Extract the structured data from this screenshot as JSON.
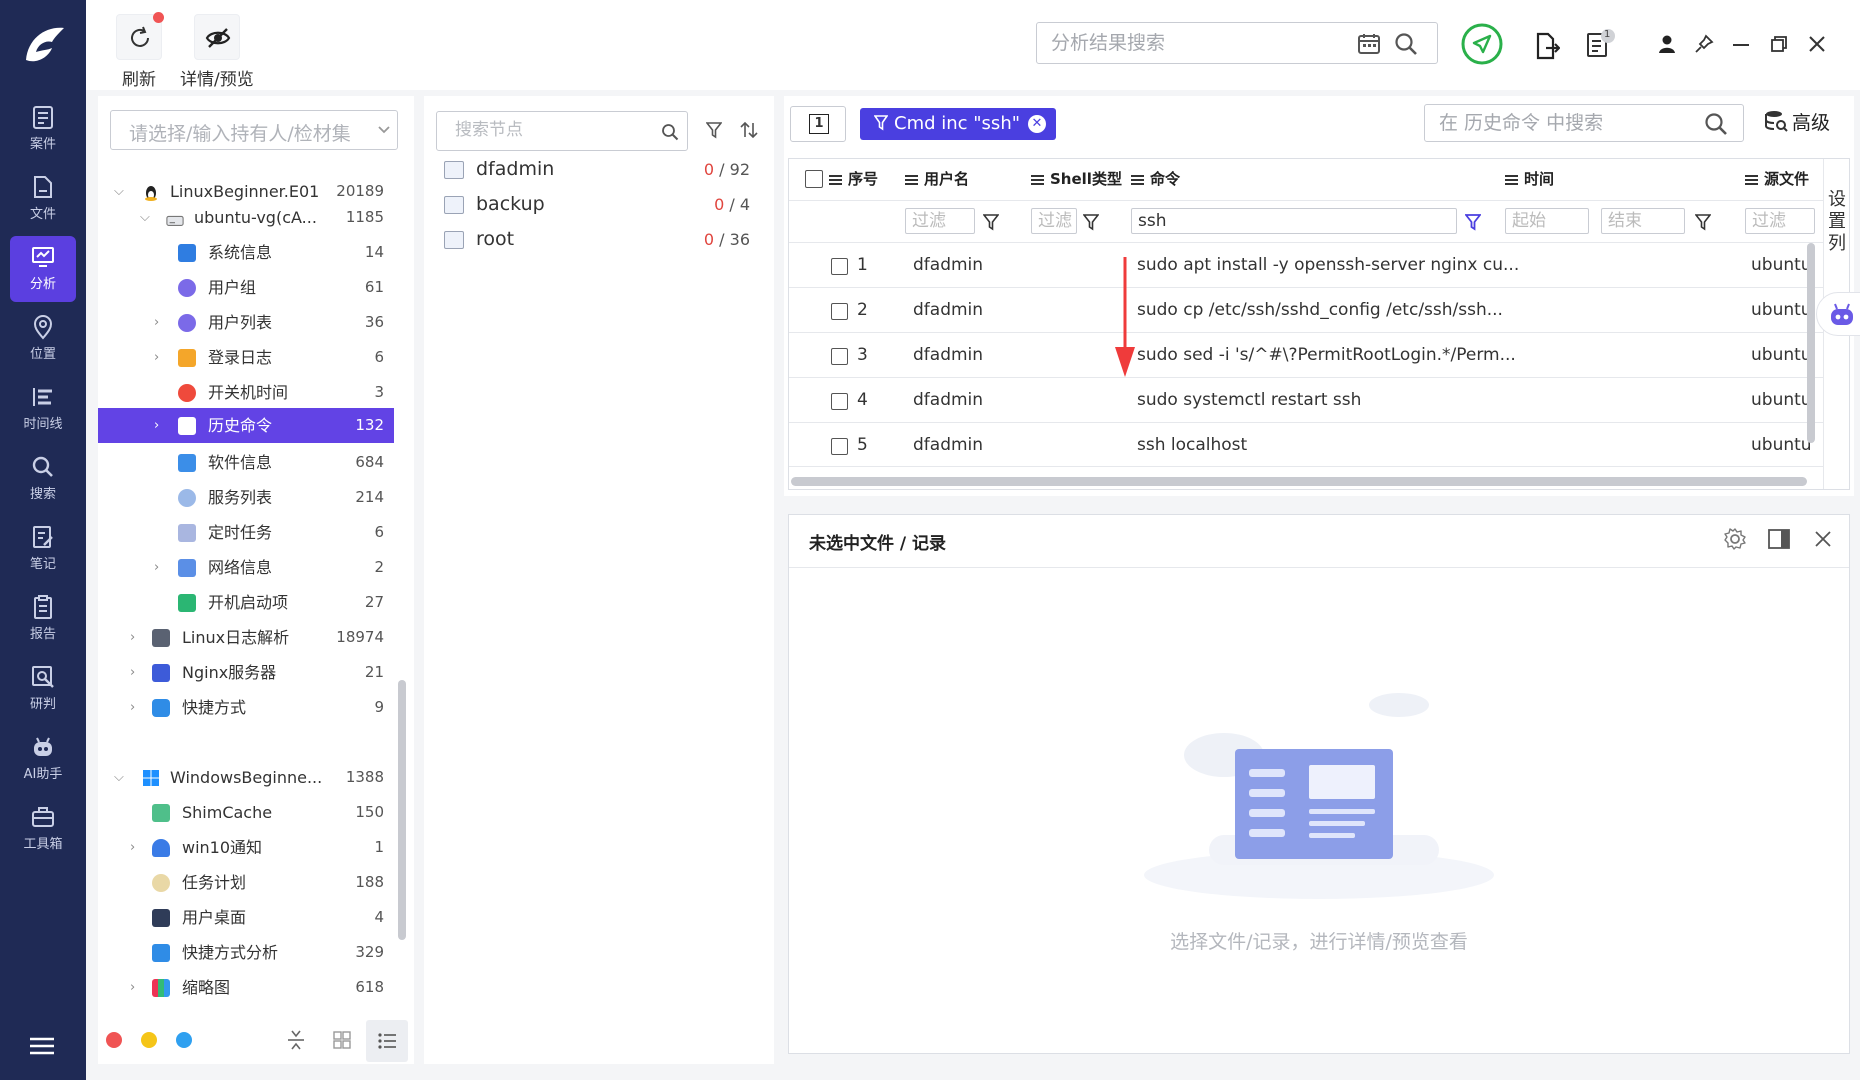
{
  "nav": {
    "items": [
      {
        "id": "case",
        "label": "案件"
      },
      {
        "id": "file",
        "label": "文件"
      },
      {
        "id": "analysis",
        "label": "分析"
      },
      {
        "id": "location",
        "label": "位置"
      },
      {
        "id": "timeline",
        "label": "时间线"
      },
      {
        "id": "search",
        "label": "搜索"
      },
      {
        "id": "notes",
        "label": "笔记"
      },
      {
        "id": "report",
        "label": "报告"
      },
      {
        "id": "judge",
        "label": "研判"
      },
      {
        "id": "ai",
        "label": "AI助手"
      },
      {
        "id": "toolbox",
        "label": "工具箱"
      }
    ],
    "active": "analysis"
  },
  "toolbar": {
    "refresh_label": "刷新",
    "detail_label": "详情/预览",
    "search_placeholder": "分析结果搜索",
    "badge_count": "1"
  },
  "tree": {
    "select_placeholder": "请选择/输入持有人/检材集",
    "rows": [
      {
        "label": "LinuxBeginner.E01",
        "count": "20189"
      },
      {
        "label": "ubuntu-vg(cA...",
        "count": "1185"
      },
      {
        "label": "系统信息",
        "count": "14"
      },
      {
        "label": "用户组",
        "count": "61"
      },
      {
        "label": "用户列表",
        "count": "36"
      },
      {
        "label": "登录日志",
        "count": "6"
      },
      {
        "label": "开关机时间",
        "count": "3"
      },
      {
        "label": "历史命令",
        "count": "132"
      },
      {
        "label": "软件信息",
        "count": "684"
      },
      {
        "label": "服务列表",
        "count": "214"
      },
      {
        "label": "定时任务",
        "count": "6"
      },
      {
        "label": "网络信息",
        "count": "2"
      },
      {
        "label": "开机启动项",
        "count": "27"
      },
      {
        "label": "Linux日志解析",
        "count": "18974"
      },
      {
        "label": "Nginx服务器",
        "count": "21"
      },
      {
        "label": "快捷方式",
        "count": "9"
      },
      {
        "label": "WindowsBeginne...",
        "count": "1388"
      },
      {
        "label": "ShimCache",
        "count": "150"
      },
      {
        "label": "win10通知",
        "count": "1"
      },
      {
        "label": "任务计划",
        "count": "188"
      },
      {
        "label": "用户桌面",
        "count": "4"
      },
      {
        "label": "快捷方式分析",
        "count": "329"
      },
      {
        "label": "缩略图",
        "count": "618"
      }
    ]
  },
  "nodes": {
    "search_placeholder": "搜索节点",
    "items": [
      {
        "label": "dfadmin",
        "hit": "0",
        "total": " / 92"
      },
      {
        "label": "backup",
        "hit": "0",
        "total": " / 4"
      },
      {
        "label": "root",
        "hit": "0",
        "total": " / 36"
      }
    ]
  },
  "results": {
    "page_num": "1",
    "chip_label": "Cmd inc \"ssh\"",
    "search_placeholder": "在 历史命令 中搜索",
    "advanced_label": "高级",
    "columns": {
      "seq": "序号",
      "user": "用户名",
      "shell": "Shell类型",
      "cmd": "命令",
      "time": "时间",
      "src": "源文件"
    },
    "filters": {
      "user": "过滤",
      "shell": "过滤",
      "cmd": "ssh",
      "start": "起始",
      "end": "结束",
      "src": "过滤"
    },
    "side_tab": "设置列",
    "rows": [
      {
        "seq": "1",
        "user": "dfadmin",
        "cmd": "sudo apt install -y openssh-server nginx cu...",
        "src": "ubuntu"
      },
      {
        "seq": "2",
        "user": "dfadmin",
        "cmd": "sudo cp /etc/ssh/sshd_config /etc/ssh/ssh...",
        "src": "ubuntu"
      },
      {
        "seq": "3",
        "user": "dfadmin",
        "cmd": "sudo sed -i 's/^#\\?PermitRootLogin.*/Perm...",
        "src": "ubuntu"
      },
      {
        "seq": "4",
        "user": "dfadmin",
        "cmd": "sudo systemctl restart ssh",
        "src": "ubuntu"
      },
      {
        "seq": "5",
        "user": "dfadmin",
        "cmd": "ssh localhost",
        "src": "ubuntu"
      }
    ]
  },
  "detail": {
    "title": "未选中文件 / 记录",
    "empty_hint": "选择文件/记录，进行详情/预览查看"
  },
  "colors": {
    "nav_bg": "#1f2a55",
    "accent": "#5b3fe0",
    "chip": "#4a3fe0",
    "red": "#e0453e",
    "green": "#2ab04a"
  }
}
